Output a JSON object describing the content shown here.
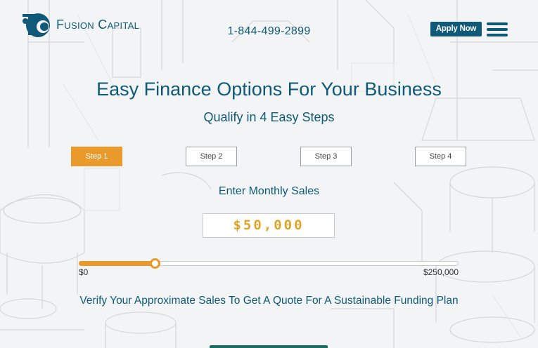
{
  "header": {
    "logo_text": "Fusion Capital",
    "phone": "1-844-499-2899",
    "apply_label": "Apply Now"
  },
  "hero": {
    "headline": "Easy Finance Options For Your Business",
    "subhead": "Qualify in 4 Easy Steps"
  },
  "steps": [
    {
      "label": "Step 1",
      "active": true
    },
    {
      "label": "Step 2",
      "active": false
    },
    {
      "label": "Step 3",
      "active": false
    },
    {
      "label": "Step 4",
      "active": false
    }
  ],
  "sales": {
    "prompt": "Enter Monthly Sales",
    "value": "$50,000",
    "slider_min": "$0",
    "slider_max": "$250,000",
    "slider_fraction": 0.2
  },
  "verify_text": "Verify Your Approximate Sales To Get A Quote For A Sustainable Funding Plan",
  "colors": {
    "brand": "#0e5a78",
    "accent": "#e99a2a",
    "amount": "#e2a224"
  },
  "icons": {
    "logo": "fusion-capital-logo-icon",
    "menu": "hamburger-menu-icon"
  }
}
